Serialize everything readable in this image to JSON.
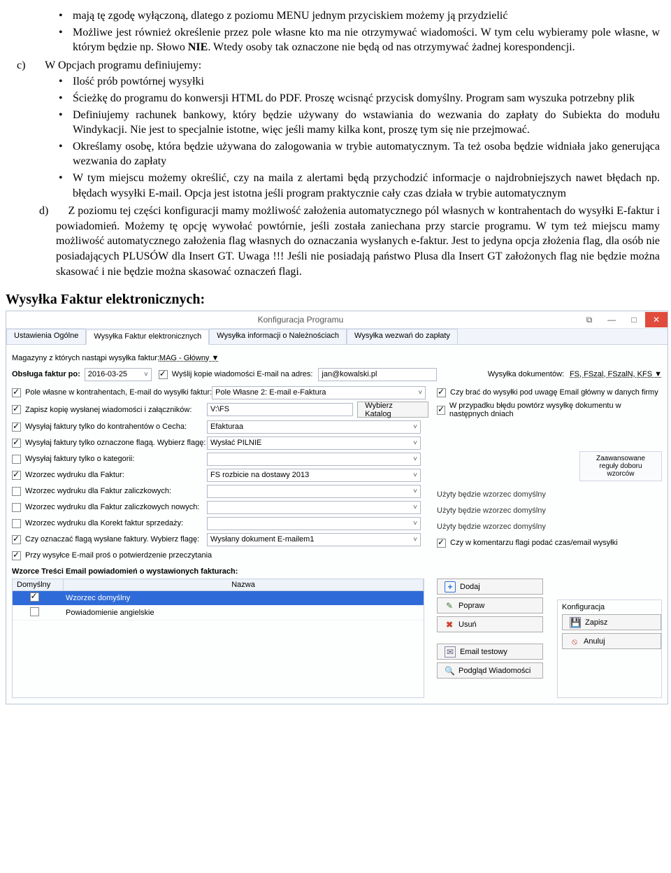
{
  "prose": {
    "b1": "mają tę zgodę wyłączoną, dlatego z poziomu MENU jednym przyciskiem możemy ją przydzielić",
    "b2a": "Możliwe jest również określenie przez pole własne kto ma nie otrzymywać wiadomości. W tym celu wybieramy pole własne, w którym będzie np. Słowo ",
    "b2b": "NIE",
    "b2c": ". Wtedy osoby tak oznaczone nie będą od nas otrzymywać żadnej korespondencji.",
    "c_label": "c)  ",
    "c_text": "W Opcjach programu definiujemy:",
    "cb1": "Ilość prób powtórnej wysyłki",
    "cb2": "Ścieżkę do programu do konwersji HTML do PDF. Proszę wcisnąć przycisk domyślny. Program sam wyszuka potrzebny plik",
    "cb3": "Definiujemy rachunek bankowy, który będzie używany do wstawiania do wezwania do zapłaty do Subiekta do modułu Windykacji. Nie jest to specjalnie istotne, więc jeśli mamy kilka kont, proszę tym się nie przejmować.",
    "cb4": "Określamy osobę, która będzie używana do zalogowania w trybie automatycznym. Ta też osoba będzie widniała jako generująca wezwania do zapłaty",
    "cb5": "W tym miejscu możemy określić, czy na maila z alertami będą przychodzić informacje o najdrobniejszych nawet błędach np. błędach wysyłki E-mail. Opcja jest istotna jeśli program praktycznie cały czas działa w trybie automatycznym",
    "d_label": "d)  ",
    "d_text": "Z poziomu tej części konfiguracji mamy możliwość założenia automatycznego pól własnych w kontrahentach do wysyłki E-faktur i powiadomień. Możemy tę opcję wywołać powtórnie, jeśli została zaniechana przy starcie programu. W tym też miejscu mamy możliwość automatycznego założenia flag własnych do oznaczania wysłanych e-faktur. Jest to jedyna opcja złożenia flag, dla osób nie posiadających PLUSÓW dla Insert GT. Uwaga !!! Jeśli nie posiadają państwo Plusa dla Insert GT założonych flag nie będzie można skasować i nie będzie można skasować oznaczeń flagi."
  },
  "section_title": "Wysyłka Faktur elektronicznych:",
  "win": {
    "title": "Konfiguracja Programu",
    "tabs": {
      "t1": "Ustawienia Ogólne",
      "t2": "Wysyłka Faktur elektronicznych",
      "t3": "Wysyłka informacji o Należnościach",
      "t4": "Wysyłka wezwań do zapłaty"
    },
    "mag_label": "Magazyny z których nastąpi wysyłka faktur:",
    "mag_value": "MAG - Główny ▼",
    "obs_label": "Obsługa faktur po:",
    "obs_date": "2016-03-25",
    "copy_chk": "Wyślij kopie wiadomości E-mail na adres:",
    "copy_val": "jan@kowalski.pl",
    "docs_label": "Wysyłka dokumentów:",
    "docs_val": "FS, FSzal, FSzalN, KFS ▼",
    "r1": "Pole własne w kontrahentach, E-mail do wysyłki faktur:",
    "r1_val": "Pole Własne 2: E-mail e-Faktura",
    "r1_rt": "Czy brać do wysyłki pod uwagę Email główny w danych firmy",
    "r2": "Zapisz kopię wysłanej wiadomości i załączników:",
    "r2_val": "V:\\FS",
    "r2_btn": "Wybierz Katalog",
    "r2_rt": "W przypadku błędu powtórz wysyłkę dokumentu w następnych dniach",
    "r3": "Wysyłaj faktury tylko do kontrahentów o Cecha:",
    "r3_val": "Efakturaa",
    "r4": "Wysyłaj faktury tylko oznaczone flagą. Wybierz flagę:",
    "r4_val": "Wysłać PILNIE",
    "r5": "Wysyłaj faktury tylko o kategorii:",
    "adv": "Zaawansowane reguły doboru wzorców",
    "r6": "Wzorzec wydruku dla Faktur:",
    "r6_val": "FS rozbicie na dostawy 2013",
    "r7": "Wzorzec wydruku dla Faktur zaliczkowych:",
    "r7_rt": "Użyty będzie wzorzec domyślny",
    "r8": "Wzorzec wydruku dla Faktur zaliczkowych nowych:",
    "r8_rt": "Użyty będzie wzorzec domyślny",
    "r9": "Wzorzec wydruku dla Korekt faktur sprzedaży:",
    "r9_rt": "Użyty będzie wzorzec domyślny",
    "r10": "Czy oznaczać flagą wysłane faktury. Wybierz flagę:",
    "r10_val": "Wysłany dokument E-mailem1",
    "r10_rt": "Czy w komentarzu flagi podać czas/email wysyłki",
    "r11": "Przy wysyłce E-mail proś o potwierdzenie przeczytania",
    "tmpl_title": "Wzorce Treści Email powiadomień o wystawionych fakturach:",
    "th1": "Domyślny",
    "th2": "Nazwa",
    "row1": "Wzorzec domyślny",
    "row2": "Powiadomienie angielskie",
    "btn_add": "Dodaj",
    "btn_edit": "Popraw",
    "btn_del": "Usuń",
    "btn_mail": "Email testowy",
    "btn_prev": "Podgląd Wiadomości",
    "cfg_title": "Konfiguracja",
    "btn_save": "Zapisz",
    "btn_cancel": "Anuluj"
  }
}
